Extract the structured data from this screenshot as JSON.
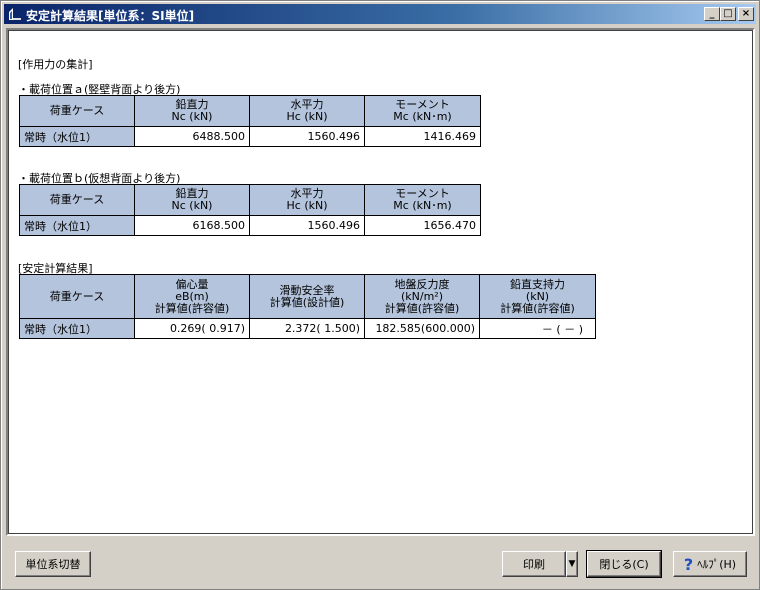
{
  "window": {
    "title": "安定計算結果[単位系：SI単位]",
    "controls": {
      "minimize": "_",
      "maximize": "□",
      "close": "×"
    }
  },
  "section1": {
    "heading": "[作用力の集計]",
    "tableA": {
      "label": "・載荷位置ａ(竪壁背面より後方)",
      "headers": [
        {
          "line1": "荷重ケース",
          "line2": ""
        },
        {
          "line1": "鉛直力",
          "line2": "Nc (kN)"
        },
        {
          "line1": "水平力",
          "line2": "Hc (kN)"
        },
        {
          "line1": "モーメント",
          "line2": "Mc (kN･m)"
        }
      ],
      "rows": [
        {
          "case": "常時（水位1）",
          "v1": "6488.500",
          "v2": "1560.496",
          "v3": "1416.469"
        }
      ]
    },
    "tableB": {
      "label": "・載荷位置ｂ(仮想背面より後方)",
      "headers": [
        {
          "line1": "荷重ケース",
          "line2": ""
        },
        {
          "line1": "鉛直力",
          "line2": "Nc (kN)"
        },
        {
          "line1": "水平力",
          "line2": "Hc (kN)"
        },
        {
          "line1": "モーメント",
          "line2": "Mc (kN･m)"
        }
      ],
      "rows": [
        {
          "case": "常時（水位1）",
          "v1": "6168.500",
          "v2": "1560.496",
          "v3": "1656.470"
        }
      ]
    }
  },
  "section2": {
    "heading": "[安定計算結果]",
    "headers": [
      {
        "line1": "荷重ケース",
        "line2": "",
        "line3": ""
      },
      {
        "line1": "偏心量",
        "line2": "eB(m)",
        "line3": "計算値(許容値)"
      },
      {
        "line1": "滑動安全率",
        "line2": "計算値(設計値)",
        "line3": ""
      },
      {
        "line1": "地盤反力度",
        "line2": "(kN/m²)",
        "line3": "計算値(許容値)"
      },
      {
        "line1": "鉛直支持力",
        "line2": "(kN)",
        "line3": "計算値(許容値)"
      }
    ],
    "rows": [
      {
        "case": "常時（水位1）",
        "v1": "0.269( 0.917)",
        "v2": "2.372( 1.500)",
        "v3": "182.585(600.000)",
        "v4": "－ ( － )"
      }
    ]
  },
  "footer": {
    "unit_switch": "単位系切替",
    "print": "印刷",
    "print_dropdown": "▼",
    "close": "閉じる(C)",
    "help": "ﾍﾙﾌﾟ(H)",
    "help_icon": "?"
  },
  "icons": {
    "app": "app-icon",
    "help": "help-question-icon"
  },
  "colors": {
    "header_bg": "#b4c4dc",
    "title_start": "#0a246a",
    "title_end": "#a6caf0"
  }
}
